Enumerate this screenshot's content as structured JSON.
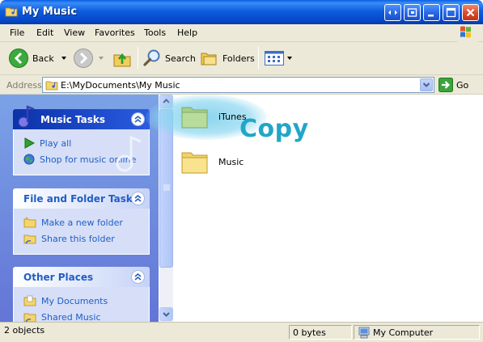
{
  "window": {
    "title": "My Music"
  },
  "menu": [
    "File",
    "Edit",
    "View",
    "Favorites",
    "Tools",
    "Help"
  ],
  "toolbar": {
    "back_label": "Back",
    "search_label": "Search",
    "folders_label": "Folders"
  },
  "address": {
    "label": "Address",
    "path": "E:\\MyDocuments\\My Music",
    "go_label": "Go"
  },
  "taskpane": {
    "music_tasks": {
      "title": "Music Tasks",
      "items": [
        "Play all",
        "Shop for music online"
      ]
    },
    "file_folder_tasks": {
      "title": "File and Folder Tasks",
      "items": [
        "Make a new folder",
        "Share this folder"
      ]
    },
    "other_places": {
      "title": "Other Places",
      "items": [
        "My Documents",
        "Shared Music"
      ]
    }
  },
  "content": {
    "items": [
      {
        "label": "iTunes",
        "highlighted": true
      },
      {
        "label": "Music",
        "highlighted": false
      }
    ],
    "overlay_text": "Copy"
  },
  "status": {
    "objects": "2 objects",
    "size": "0 bytes",
    "location": "My Computer"
  },
  "colors": {
    "title_blue": "#0a5fe4",
    "task_link": "#215dc6",
    "copy_overlay": "#22a6c8",
    "chrome": "#ece9d8"
  }
}
